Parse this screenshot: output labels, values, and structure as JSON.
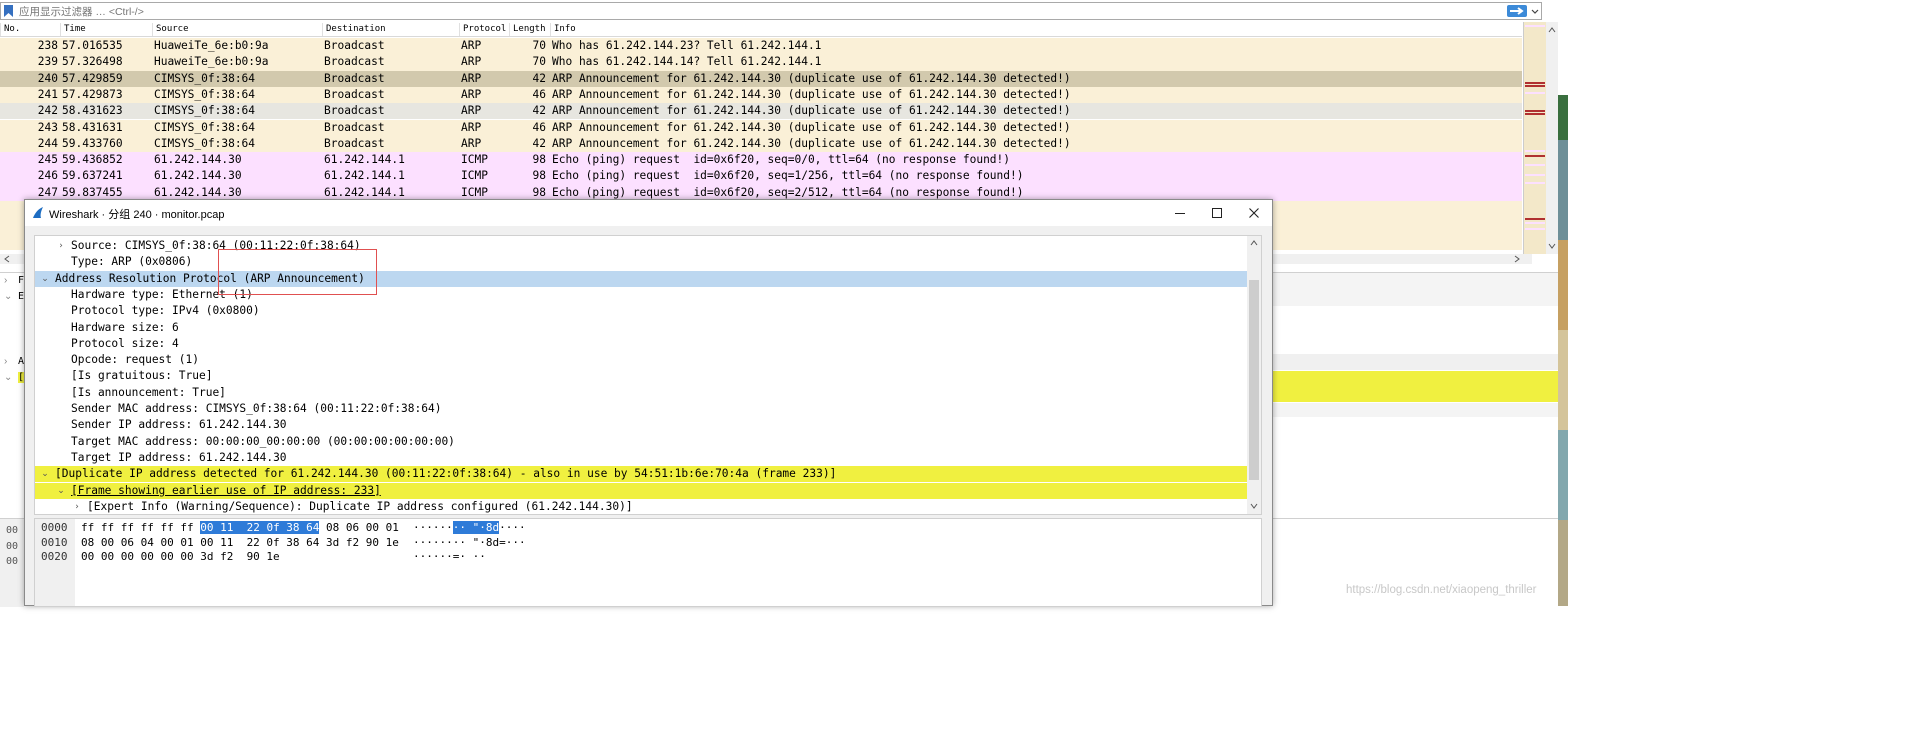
{
  "filter": {
    "placeholder": "应用显示过滤器 … <Ctrl-/>",
    "apply_icon": "arrow-right-icon",
    "colors": {
      "apply": "#3c8ad8"
    }
  },
  "packet_list": {
    "columns": [
      "No.",
      "Time",
      "Source",
      "Destination",
      "Protocol",
      "Length",
      "Info"
    ],
    "rows": [
      {
        "no": "238",
        "time": "57.016535",
        "src": "HuaweiTe_6e:b0:9a",
        "dst": "Broadcast",
        "proto": "ARP",
        "len": "70",
        "info": "Who has 61.242.144.23? Tell 61.242.144.1",
        "color": "#faf0d7"
      },
      {
        "no": "239",
        "time": "57.326498",
        "src": "HuaweiTe_6e:b0:9a",
        "dst": "Broadcast",
        "proto": "ARP",
        "len": "70",
        "info": "Who has 61.242.144.14? Tell 61.242.144.1",
        "color": "#faf0d7"
      },
      {
        "no": "240",
        "time": "57.429859",
        "src": "CIMSYS_0f:38:64",
        "dst": "Broadcast",
        "proto": "ARP",
        "len": "42",
        "info": "ARP Announcement for 61.242.144.30 (duplicate use of 61.242.144.30 detected!)",
        "color": "#d2c9ad"
      },
      {
        "no": "241",
        "time": "57.429873",
        "src": "CIMSYS_0f:38:64",
        "dst": "Broadcast",
        "proto": "ARP",
        "len": "46",
        "info": "ARP Announcement for 61.242.144.30 (duplicate use of 61.242.144.30 detected!)",
        "color": "#faf0d7"
      },
      {
        "no": "242",
        "time": "58.431623",
        "src": "CIMSYS_0f:38:64",
        "dst": "Broadcast",
        "proto": "ARP",
        "len": "42",
        "info": "ARP Announcement for 61.242.144.30 (duplicate use of 61.242.144.30 detected!)",
        "color": "#e7e6e0"
      },
      {
        "no": "243",
        "time": "58.431631",
        "src": "CIMSYS_0f:38:64",
        "dst": "Broadcast",
        "proto": "ARP",
        "len": "46",
        "info": "ARP Announcement for 61.242.144.30 (duplicate use of 61.242.144.30 detected!)",
        "color": "#faf0d7"
      },
      {
        "no": "244",
        "time": "59.433760",
        "src": "CIMSYS_0f:38:64",
        "dst": "Broadcast",
        "proto": "ARP",
        "len": "42",
        "info": "ARP Announcement for 61.242.144.30 (duplicate use of 61.242.144.30 detected!)",
        "color": "#faf0d7"
      },
      {
        "no": "245",
        "time": "59.436852",
        "src": "61.242.144.30",
        "dst": "61.242.144.1",
        "proto": "ICMP",
        "len": "98",
        "info": "Echo (ping) request  id=0x6f20, seq=0/0, ttl=64 (no response found!)",
        "color": "#fce0ff"
      },
      {
        "no": "246",
        "time": "59.637241",
        "src": "61.242.144.30",
        "dst": "61.242.144.1",
        "proto": "ICMP",
        "len": "98",
        "info": "Echo (ping) request  id=0x6f20, seq=1/256, ttl=64 (no response found!)",
        "color": "#fce0ff"
      },
      {
        "no": "247",
        "time": "59.837455",
        "src": "61.242.144.30",
        "dst": "61.242.144.1",
        "proto": "ICMP",
        "len": "98",
        "info": "Echo (ping) request  id=0x6f20, seq=2/512, ttl=64 (no response found!)",
        "color": "#fce0ff"
      }
    ]
  },
  "background_panes": {
    "detail_letters": [
      "F",
      "E",
      "A",
      "["
    ],
    "bytes_offsets": [
      "00",
      "00",
      "00"
    ]
  },
  "dialog": {
    "title": "Wireshark · 分组 240 · monitor.pcap",
    "icons": {
      "app": "wireshark-fin-icon",
      "minimize": "minimize-icon",
      "maximize": "maximize-icon",
      "close": "close-icon"
    },
    "tree": [
      {
        "indent": 1,
        "arrow": "›",
        "text": "Source: CIMSYS_0f:38:64 (00:11:22:0f:38:64)",
        "style": "normal"
      },
      {
        "indent": 1,
        "arrow": "",
        "text": "Type: ARP (0x0806)",
        "style": "normal"
      },
      {
        "indent": 0,
        "arrow": "⌄",
        "text": "Address Resolution Protocol (ARP Announcement)",
        "style": "selected"
      },
      {
        "indent": 1,
        "arrow": "",
        "text": "Hardware type: Ethernet (1)",
        "style": "normal"
      },
      {
        "indent": 1,
        "arrow": "",
        "text": "Protocol type: IPv4 (0x0800)",
        "style": "normal"
      },
      {
        "indent": 1,
        "arrow": "",
        "text": "Hardware size: 6",
        "style": "normal"
      },
      {
        "indent": 1,
        "arrow": "",
        "text": "Protocol size: 4",
        "style": "normal"
      },
      {
        "indent": 1,
        "arrow": "",
        "text": "Opcode: request (1)",
        "style": "normal"
      },
      {
        "indent": 1,
        "arrow": "",
        "text": "[Is gratuitous: True]",
        "style": "normal"
      },
      {
        "indent": 1,
        "arrow": "",
        "text": "[Is announcement: True]",
        "style": "normal"
      },
      {
        "indent": 1,
        "arrow": "",
        "text": "Sender MAC address: CIMSYS_0f:38:64 (00:11:22:0f:38:64)",
        "style": "normal"
      },
      {
        "indent": 1,
        "arrow": "",
        "text": "Sender IP address: 61.242.144.30",
        "style": "normal"
      },
      {
        "indent": 1,
        "arrow": "",
        "text": "Target MAC address: 00:00:00_00:00:00 (00:00:00:00:00:00)",
        "style": "normal"
      },
      {
        "indent": 1,
        "arrow": "",
        "text": "Target IP address: 61.242.144.30",
        "style": "normal"
      },
      {
        "indent": 0,
        "arrow": "⌄",
        "text": "[Duplicate IP address detected for 61.242.144.30 (00:11:22:0f:38:64) - also in use by 54:51:1b:6e:70:4a (frame 233)]",
        "style": "warning"
      },
      {
        "indent": 1,
        "arrow": "⌄",
        "text": "[Frame showing earlier use of IP address: 233]",
        "style": "warning-link"
      },
      {
        "indent": 2,
        "arrow": "›",
        "text": "[Expert Info (Warning/Sequence): Duplicate IP address configured (61.242.144.30)]",
        "style": "normal"
      }
    ],
    "bytes": [
      {
        "offset": "0000",
        "hex_pre": "ff ff ff ff ff ff ",
        "hex_hl": "00 11  22 0f 38 64",
        "hex_post": " 08 06 00 01",
        "asc_pre": "······",
        "asc_hl": "·· \"·8d",
        "asc_post": "····"
      },
      {
        "offset": "0010",
        "hex_pre": "08 00 06 04 00 01 00 11  22 0f 38 64 3d f2 90 1e",
        "hex_hl": "",
        "hex_post": "",
        "asc_pre": "········ \"·8d=···",
        "asc_hl": "",
        "asc_post": ""
      },
      {
        "offset": "0020",
        "hex_pre": "00 00 00 00 00 00 3d f2  90 1e",
        "hex_hl": "",
        "hex_post": "",
        "asc_pre": "······=· ··",
        "asc_hl": "",
        "asc_post": ""
      }
    ],
    "colors": {
      "selected": "#bcd7f0",
      "warning": "#f0f040",
      "byte_highlight": "#2e7bd8"
    }
  },
  "watermark": "https://blog.csdn.net/xiaopeng_thriller"
}
